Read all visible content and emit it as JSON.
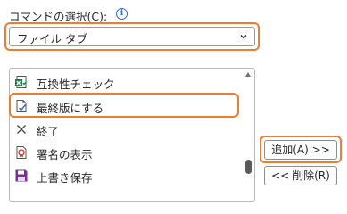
{
  "command_source": {
    "label": "コマンドの選択(C):",
    "info_icon": "info-icon",
    "selected": "ファイル タブ"
  },
  "command_list": {
    "items": [
      {
        "label": "互換性チェック",
        "icon": "compatibility-checker-icon"
      },
      {
        "label": "最終版にする",
        "icon": "mark-as-final-icon",
        "highlighted": true
      },
      {
        "label": "終了",
        "icon": "close-icon"
      },
      {
        "label": "署名の表示",
        "icon": "view-signatures-icon"
      },
      {
        "label": "上書き保存",
        "icon": "save-icon"
      }
    ]
  },
  "buttons": {
    "add": "追加(A) >>",
    "remove": "<< 削除(R)"
  },
  "colors": {
    "highlight": "#ed7d31",
    "info": "#2f6bd7",
    "save_icon": "#7b2f8f"
  }
}
